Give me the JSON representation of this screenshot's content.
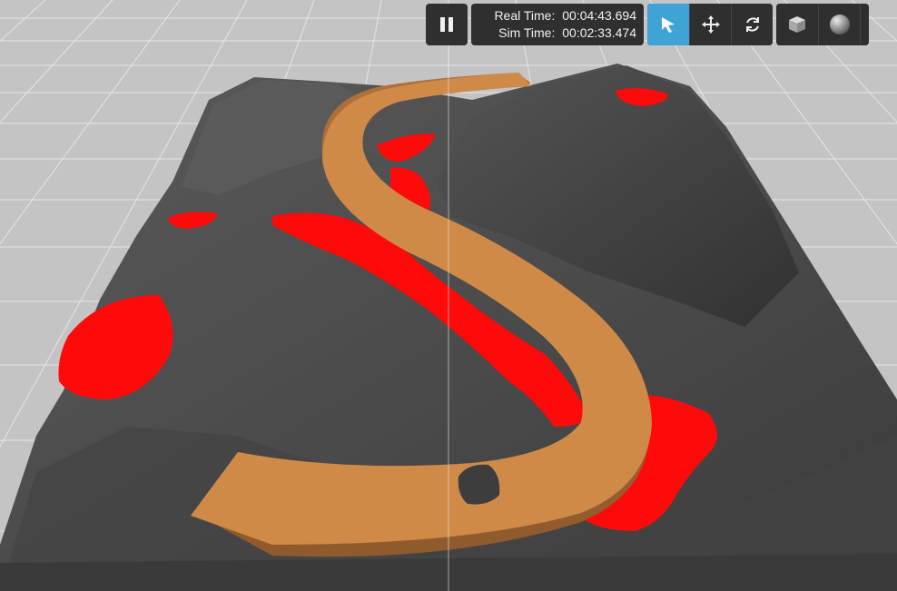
{
  "toolbar": {
    "pause_icon": "pause-icon",
    "real_time_label": "Real Time:",
    "real_time_value": "00:04:43.694",
    "sim_time_label": "Sim Time:",
    "sim_time_value": "00:02:33.474",
    "tools": [
      {
        "name": "select-mode",
        "icon": "cursor-arrow-icon",
        "active": true
      },
      {
        "name": "translate-mode",
        "icon": "move-arrows-icon",
        "active": false
      },
      {
        "name": "rotate-mode",
        "icon": "rotate-arrows-icon",
        "active": false
      }
    ],
    "shapes": [
      {
        "name": "box-shape",
        "icon": "cube-icon"
      },
      {
        "name": "sphere-shape",
        "icon": "sphere-icon"
      }
    ]
  },
  "scene": {
    "background_color": "#c9c9c9",
    "terrain_color": "#505050",
    "lava_color": "#ff0a0a",
    "track_color": "#cf8a48",
    "active_tool_color": "#3fa3d6"
  }
}
